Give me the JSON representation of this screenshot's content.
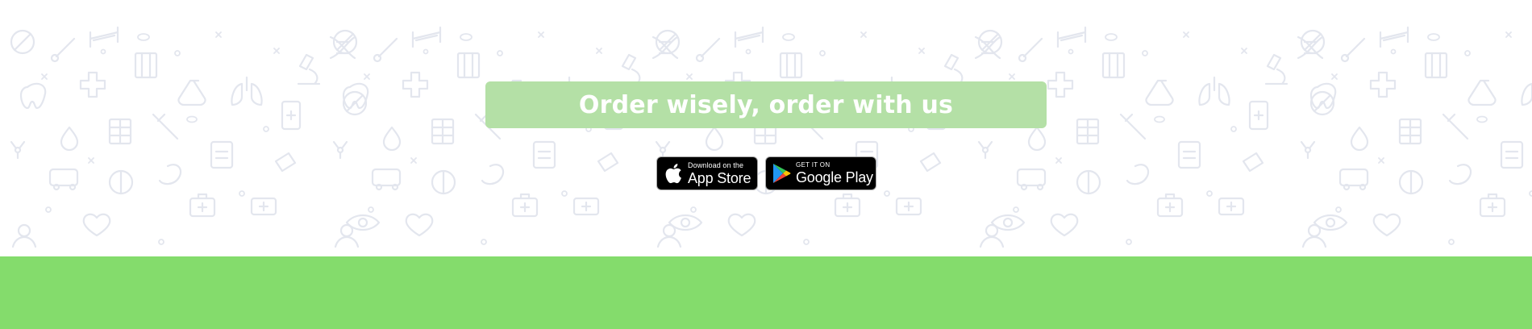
{
  "pattern": {
    "icon_color": "#e3e6ee",
    "icons": [
      "pill-icon",
      "thermometer-icon",
      "syringe-icon",
      "dna-icon",
      "cross-icon",
      "tooth-icon",
      "lungs-icon",
      "microscope-icon",
      "flask-icon",
      "clipboard-icon",
      "heart-icon",
      "eye-icon",
      "ambulance-icon",
      "stomach-icon",
      "drop-icon",
      "doctor-icon",
      "medical-bag-icon",
      "radiation-icon",
      "test-tubes-icon",
      "hospital-bed-icon"
    ]
  },
  "banner": {
    "text": "Order wisely, order with us",
    "color": "#b4e0a6"
  },
  "store_badges": {
    "apple": {
      "small_text": "Download on the",
      "large_text": "App Store",
      "icon": "apple-icon"
    },
    "google": {
      "small_text": "GET IT ON",
      "large_text": "Google Play",
      "icon": "google-play-icon"
    }
  },
  "footer": {
    "color": "#84dc6c"
  }
}
